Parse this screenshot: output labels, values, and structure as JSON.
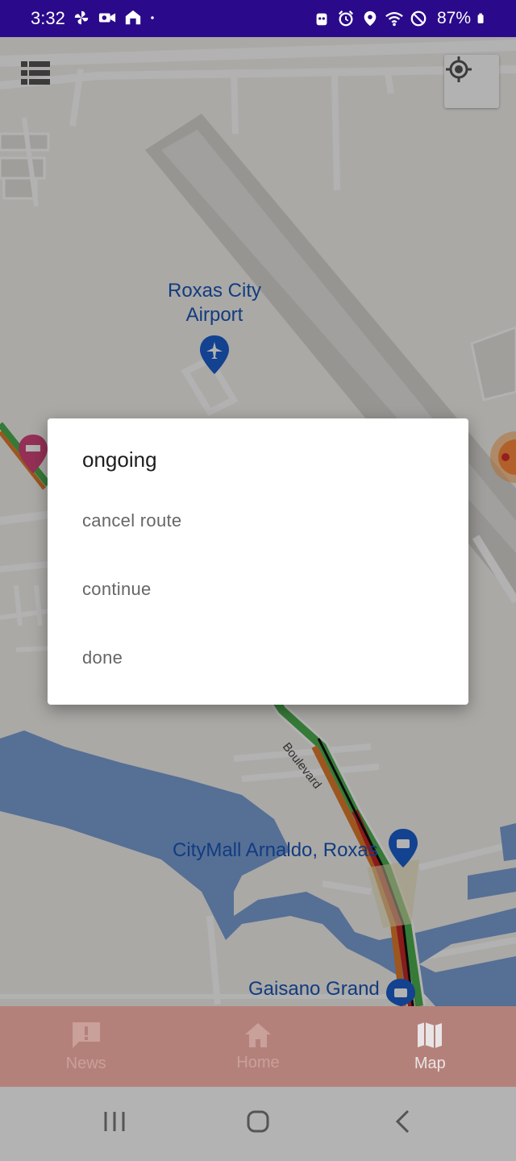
{
  "status_bar": {
    "time": "3:32",
    "battery": "87%",
    "left_icons": [
      "pinwheel-icon",
      "video-camera-icon",
      "home-icon",
      "dot-icon"
    ],
    "right_icons": [
      "robot-icon",
      "alarm-icon",
      "location-icon",
      "wifi-icon",
      "do-not-disturb-icon",
      "battery-icon"
    ]
  },
  "map": {
    "labels": {
      "airport": "Roxas City\nAirport",
      "mall": "CityMall Arnaldo, Roxas",
      "gaisano": "Gaisano Grand",
      "road": "Boulevard"
    },
    "colors": {
      "water": "#7c9fd6",
      "road": "#ffffff",
      "land": "#f4f2ee",
      "pin_blue": "#1a5fcf",
      "pin_pink": "#d5467b"
    }
  },
  "dialog": {
    "title": "ongoing",
    "options": [
      "cancel route",
      "continue",
      "done"
    ]
  },
  "bottom_nav": {
    "items": [
      {
        "label": "News",
        "icon": "alert-message-icon",
        "active": false
      },
      {
        "label": "Home",
        "icon": "home-icon",
        "active": false
      },
      {
        "label": "Map",
        "icon": "map-icon",
        "active": true
      }
    ],
    "background": "#b4817a"
  },
  "system_nav": {
    "icons": [
      "recents-icon",
      "home-circle-icon",
      "back-icon"
    ]
  }
}
